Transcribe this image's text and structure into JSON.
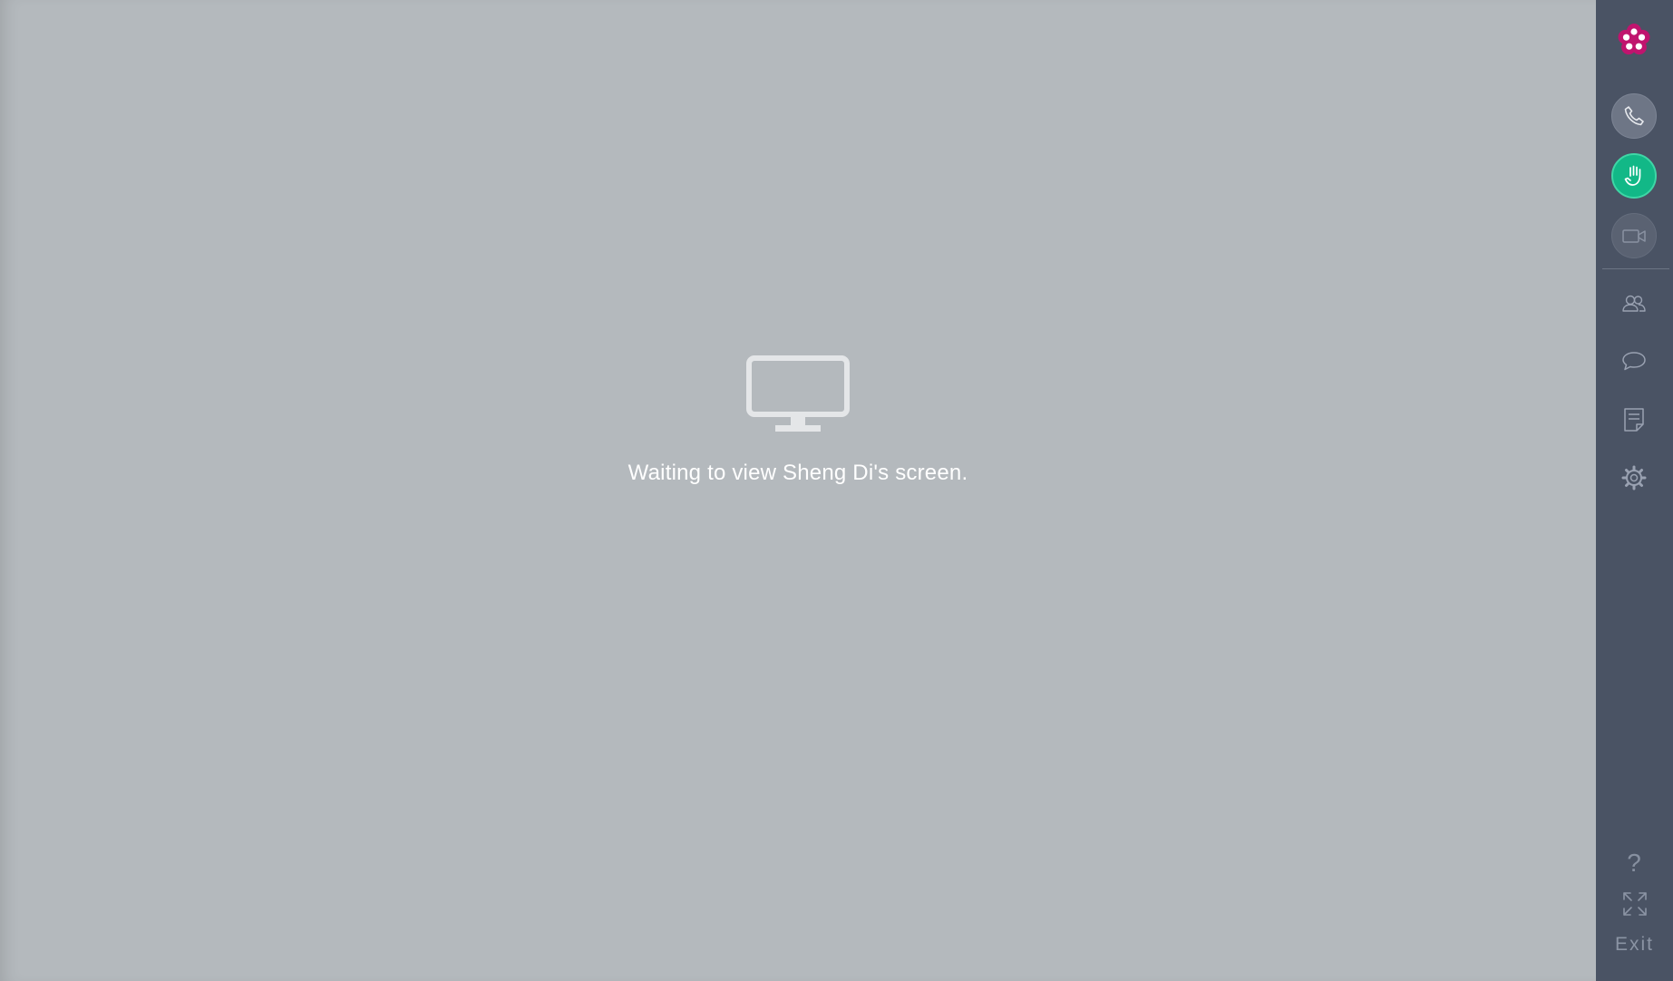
{
  "main": {
    "status_icon": "monitor-icon",
    "status_text": "Waiting to view Sheng Di's screen."
  },
  "sidebar": {
    "logo_icon": "flower-logo-icon",
    "buttons": [
      {
        "name": "phone-button",
        "icon": "phone-icon",
        "state": "default"
      },
      {
        "name": "raise-hand-button",
        "icon": "hand-icon",
        "state": "active",
        "color": "#12b887"
      },
      {
        "name": "video-button",
        "icon": "video-camera-icon",
        "state": "disabled"
      }
    ],
    "nav": [
      {
        "name": "participants",
        "icon": "users-icon"
      },
      {
        "name": "chat",
        "icon": "chat-bubble-icon"
      },
      {
        "name": "notes",
        "icon": "notes-icon"
      },
      {
        "name": "settings",
        "icon": "gear-icon"
      }
    ],
    "help_glyph": "?",
    "expand_icon": "expand-icon",
    "exit_label": "Exit"
  },
  "colors": {
    "main_background": "#b4b9bd",
    "sidebar_background": "#4a5364",
    "accent_green": "#12b887",
    "logo_magenta": "#c0146e"
  }
}
